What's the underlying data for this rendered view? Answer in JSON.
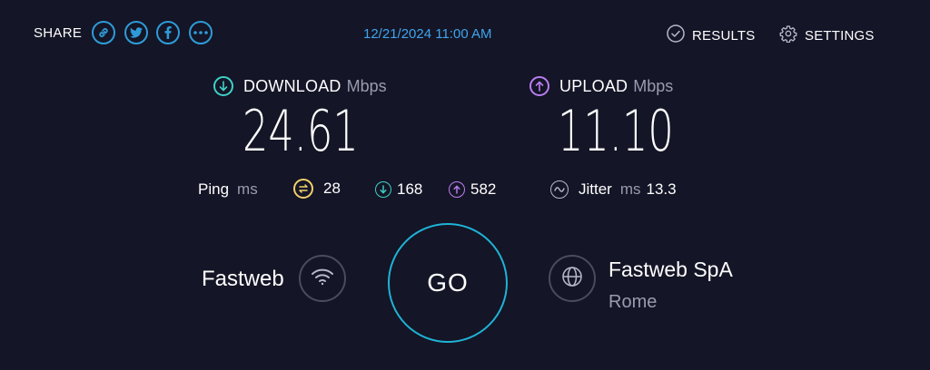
{
  "header": {
    "share_label": "SHARE",
    "share_buttons": [
      {
        "icon": "link-icon"
      },
      {
        "icon": "twitter-icon"
      },
      {
        "icon": "facebook-icon"
      },
      {
        "icon": "more-icon"
      }
    ],
    "timestamp": "12/21/2024 11:00 AM",
    "results_label": "RESULTS",
    "settings_label": "SETTINGS"
  },
  "download": {
    "label": "DOWNLOAD",
    "unit": "Mbps",
    "value": "24.61",
    "color": "#3ed1c6"
  },
  "upload": {
    "label": "UPLOAD",
    "unit": "Mbps",
    "value": "11.10",
    "color": "#b97ef0"
  },
  "ping": {
    "label": "Ping",
    "unit": "ms",
    "idle": "28",
    "download": "168",
    "upload": "582",
    "idle_color": "#f2d06b"
  },
  "jitter": {
    "label": "Jitter",
    "unit": "ms",
    "value": "13.3"
  },
  "connection": {
    "isp": "Fastweb",
    "go_label": "GO",
    "server_name": "Fastweb SpA",
    "server_location": "Rome"
  },
  "colors": {
    "background": "#141526",
    "accent_blue": "#2e9bd8",
    "go_ring": "#1fb3d6"
  }
}
